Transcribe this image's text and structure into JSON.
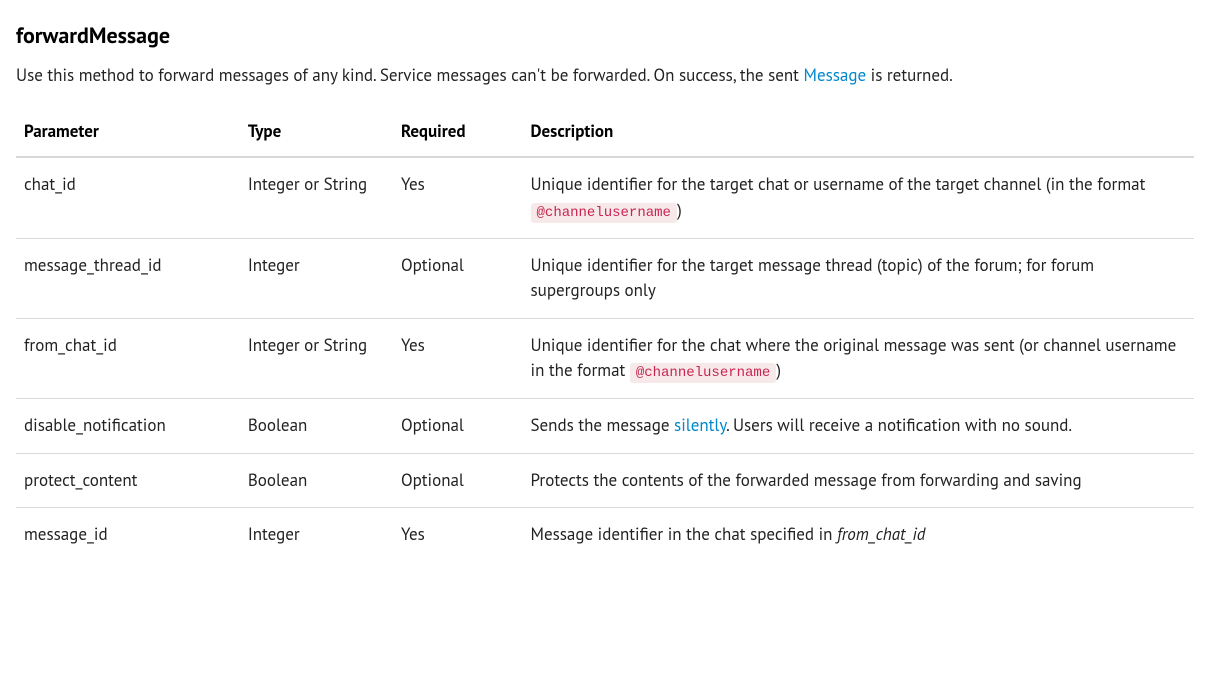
{
  "title": "forwardMessage",
  "intro": {
    "before_link": "Use this method to forward messages of any kind. Service messages can't be forwarded. On success, the sent ",
    "link_text": "Message",
    "after_link": " is returned."
  },
  "table": {
    "headers": {
      "parameter": "Parameter",
      "type": "Type",
      "required": "Required",
      "description": "Description"
    },
    "rows": [
      {
        "param": "chat_id",
        "type": "Integer or String",
        "required": "Yes",
        "desc_before": "Unique identifier for the target chat or username of the target channel (in the format ",
        "desc_code": "@channelusername",
        "desc_after": ")"
      },
      {
        "param": "message_thread_id",
        "type": "Integer",
        "required": "Optional",
        "desc_plain": "Unique identifier for the target message thread (topic) of the forum; for forum supergroups only"
      },
      {
        "param": "from_chat_id",
        "type": "Integer or String",
        "required": "Yes",
        "desc_before": "Unique identifier for the chat where the original message was sent (or channel username in the format ",
        "desc_code": "@channelusername",
        "desc_after": ")"
      },
      {
        "param": "disable_notification",
        "type": "Boolean",
        "required": "Optional",
        "desc_before": "Sends the message ",
        "desc_link": "silently",
        "desc_after": ". Users will receive a notification with no sound."
      },
      {
        "param": "protect_content",
        "type": "Boolean",
        "required": "Optional",
        "desc_plain": "Protects the contents of the forwarded message from forwarding and saving"
      },
      {
        "param": "message_id",
        "type": "Integer",
        "required": "Yes",
        "desc_before": "Message identifier in the chat specified in ",
        "desc_em": "from_chat_id"
      }
    ]
  }
}
